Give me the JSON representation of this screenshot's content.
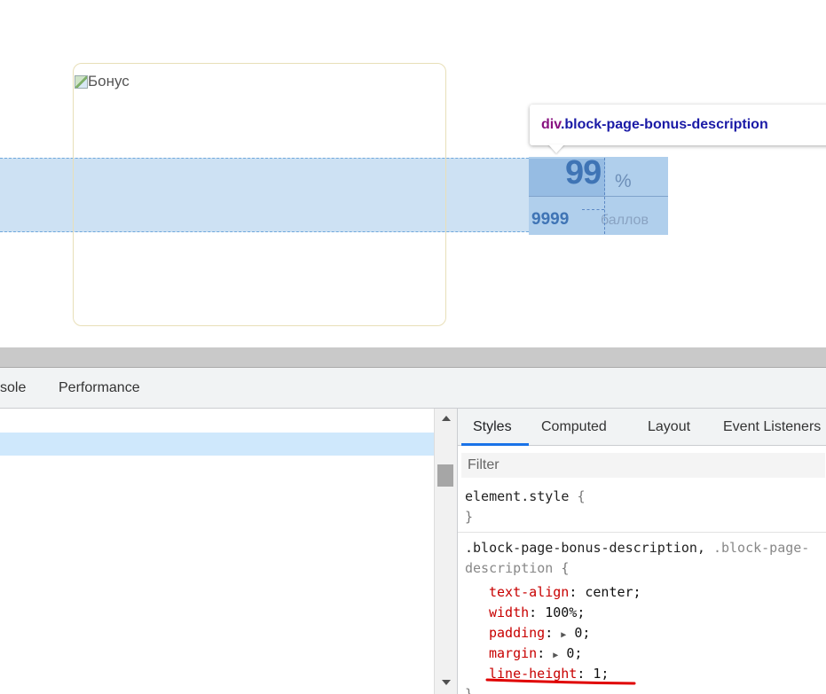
{
  "viewport": {
    "bonus_image_alt": "Бонус",
    "tooltip": {
      "tag": "div",
      "class_name": ".block-page-bonus-description"
    },
    "bonus": {
      "percent": "99",
      "percent_sign": "%",
      "points": "9999",
      "points_label": "баллов"
    }
  },
  "devtools": {
    "tabs": [
      "sole",
      "Performance"
    ],
    "styles_tabs": [
      "Styles",
      "Computed",
      "Layout",
      "Event Listeners"
    ],
    "active_styles_tab": "Styles",
    "filter_placeholder": "Filter",
    "rules": {
      "element_style": {
        "selector": "element.style",
        "open": "{",
        "close": "}"
      },
      "rule2": {
        "selector_line1_a": ".block-page-bonus-description,",
        "selector_line1_b": " .block-page-",
        "selector_line2": "description",
        "open": " {",
        "declarations": [
          {
            "prop": "text-align",
            "value": "center;"
          },
          {
            "prop": "width",
            "value": "100%;"
          },
          {
            "prop": "padding",
            "arrow": "▶",
            "value": "0;"
          },
          {
            "prop": "margin",
            "arrow": "▶",
            "value": "0;"
          },
          {
            "prop": "line-height",
            "value": "1;"
          }
        ],
        "close": "}"
      }
    },
    "colors": {
      "selection": "#cfe8fc",
      "active_tab_underline": "#1a73e8",
      "annotation": "#e00000",
      "property": "#c80000"
    }
  }
}
